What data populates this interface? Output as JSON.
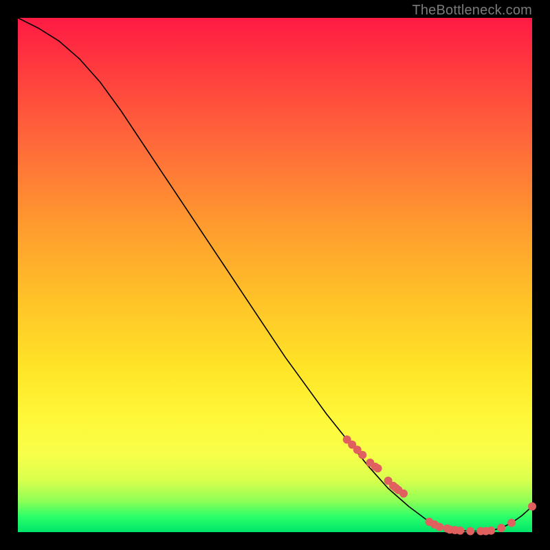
{
  "attribution": "TheBottleneck.com",
  "chart_data": {
    "type": "line",
    "title": "",
    "xlabel": "",
    "ylabel": "",
    "xlim": [
      0,
      100
    ],
    "ylim": [
      0,
      100
    ],
    "series": [
      {
        "name": "curve",
        "x": [
          0,
          4,
          8,
          12,
          16,
          20,
          24,
          28,
          32,
          36,
          40,
          44,
          48,
          52,
          56,
          60,
          64,
          68,
          72,
          76,
          80,
          82,
          84,
          86,
          88,
          90,
          92,
          94,
          96,
          98,
          100
        ],
        "y": [
          100,
          98,
          95.5,
          92,
          87.5,
          82,
          76,
          70,
          64,
          58,
          52,
          46,
          40,
          34,
          28.5,
          23,
          18,
          13,
          8.5,
          5,
          2,
          1,
          0.5,
          0.3,
          0.2,
          0.2,
          0.3,
          0.8,
          1.8,
          3.2,
          5
        ]
      }
    ],
    "scatter": {
      "name": "highlighted-points",
      "x": [
        64,
        65,
        66,
        67,
        68.5,
        69.5,
        70,
        72,
        73,
        73.5,
        74,
        75,
        80,
        81,
        82,
        83.5,
        84,
        85,
        86,
        88,
        90,
        91,
        92,
        94,
        96,
        100
      ],
      "y": [
        18,
        17,
        16,
        15,
        13.5,
        12.7,
        12.4,
        10,
        9,
        8.6,
        8.2,
        7.5,
        2,
        1.5,
        1,
        0.7,
        0.5,
        0.4,
        0.3,
        0.2,
        0.2,
        0.2,
        0.3,
        0.8,
        1.8,
        5
      ]
    },
    "colors": {
      "curve": "#000000",
      "points": "#e06060",
      "background_top": "#ff1a44",
      "background_bottom": "#00e46a"
    }
  }
}
